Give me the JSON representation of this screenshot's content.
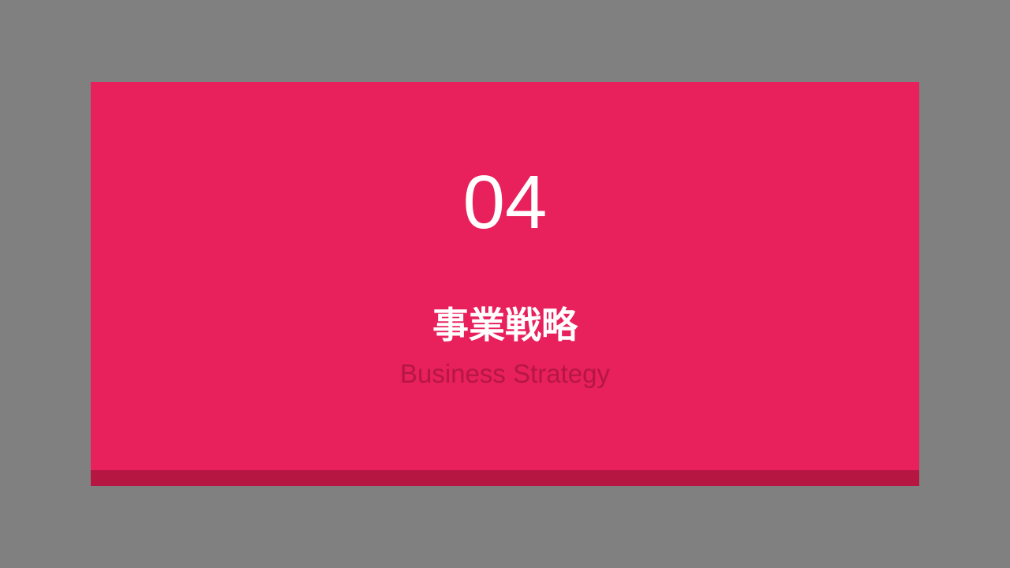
{
  "slide": {
    "number": "04",
    "title": "事業戦略",
    "subtitle": "Business Strategy"
  },
  "colors": {
    "background": "#808080",
    "card": "#E8205C",
    "card_band": "#B51742",
    "title_text": "#FFFFFF",
    "subtitle_text": "#B51742"
  }
}
